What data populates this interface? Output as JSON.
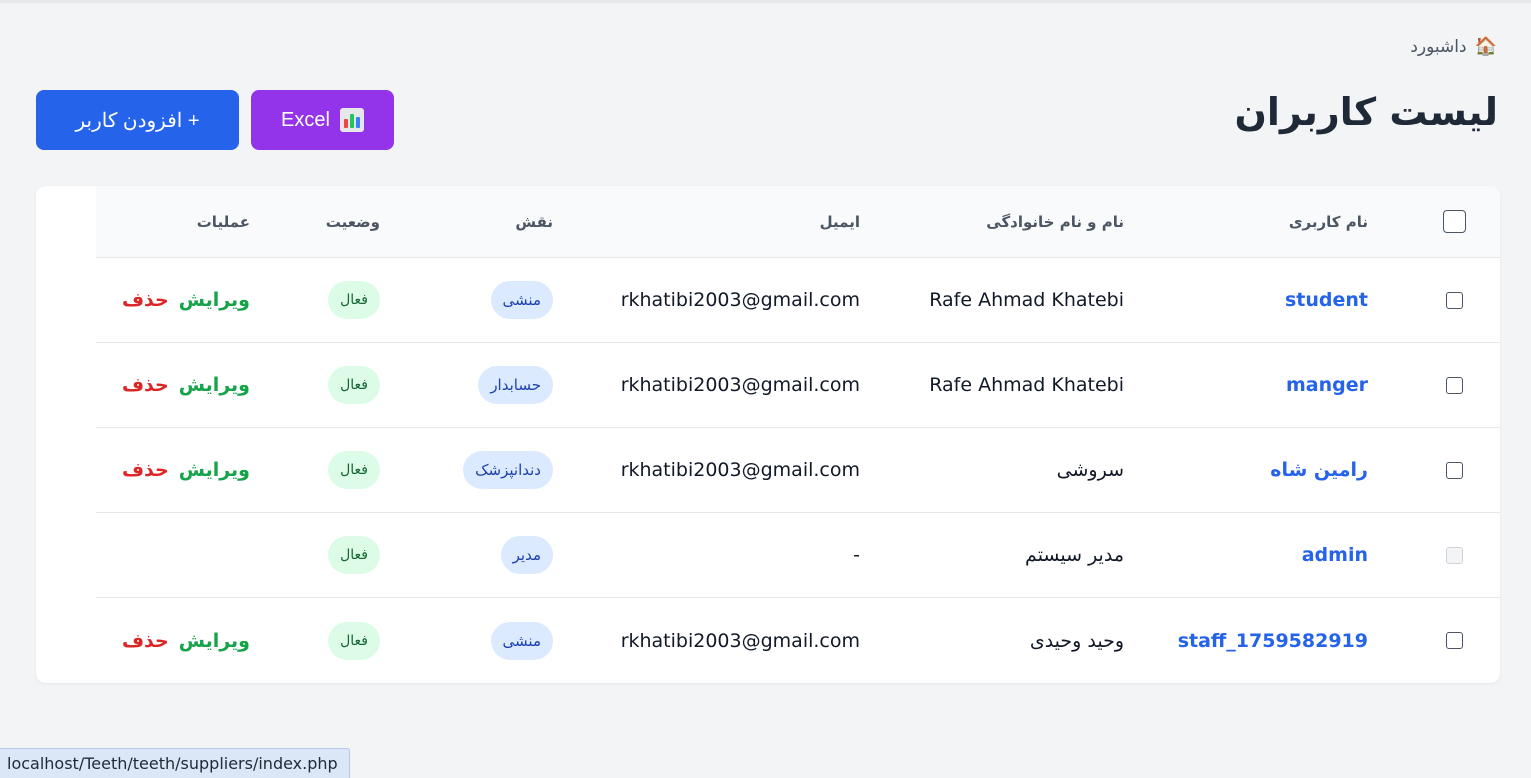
{
  "breadcrumb": {
    "icon": "home-icon",
    "label": "داشبورد"
  },
  "page": {
    "title": "لیست کاربران"
  },
  "buttons": {
    "excel_label": "Excel",
    "excel_icon": "bar-chart-icon",
    "add_label": "+ افزودن کاربر"
  },
  "colors": {
    "primary": "#2563eb",
    "excel": "#9333ea",
    "edit": "#16a34a",
    "delete": "#dc2626"
  },
  "table": {
    "headers": {
      "username": "نام کاربری",
      "fullname": "نام و نام خانوادگی",
      "email": "ایمیل",
      "role": "نقش",
      "status": "وضعیت",
      "actions": "عملیات"
    },
    "rows": [
      {
        "username": "student",
        "fullname": "Rafe Ahmad Khatebi",
        "email": "rkhatibi2003@gmail.com",
        "role": "منشی",
        "status": "فعال",
        "edit": "ویرایش",
        "delete": "حذف",
        "checkbox_disabled": false
      },
      {
        "username": "manger",
        "fullname": "Rafe Ahmad Khatebi",
        "email": "rkhatibi2003@gmail.com",
        "role": "حسابدار",
        "status": "فعال",
        "edit": "ویرایش",
        "delete": "حذف",
        "checkbox_disabled": false
      },
      {
        "username": "رامین شاه",
        "fullname": "سروشی",
        "email": "rkhatibi2003@gmail.com",
        "role": "دندانپزشک",
        "status": "فعال",
        "edit": "ویرایش",
        "delete": "حذف",
        "checkbox_disabled": false
      },
      {
        "username": "admin",
        "fullname": "مدیر سیستم",
        "email": "-",
        "role": "مدیر",
        "status": "فعال",
        "edit": "",
        "delete": "",
        "checkbox_disabled": true
      },
      {
        "username": "staff_1759582919",
        "fullname": "وحید وحیدی",
        "email": "rkhatibi2003@gmail.com",
        "role": "منشی",
        "status": "فعال",
        "edit": "ویرایش",
        "delete": "حذف",
        "checkbox_disabled": false
      }
    ]
  },
  "statusbar": {
    "url": "localhost/Teeth/teeth/suppliers/index.php"
  }
}
